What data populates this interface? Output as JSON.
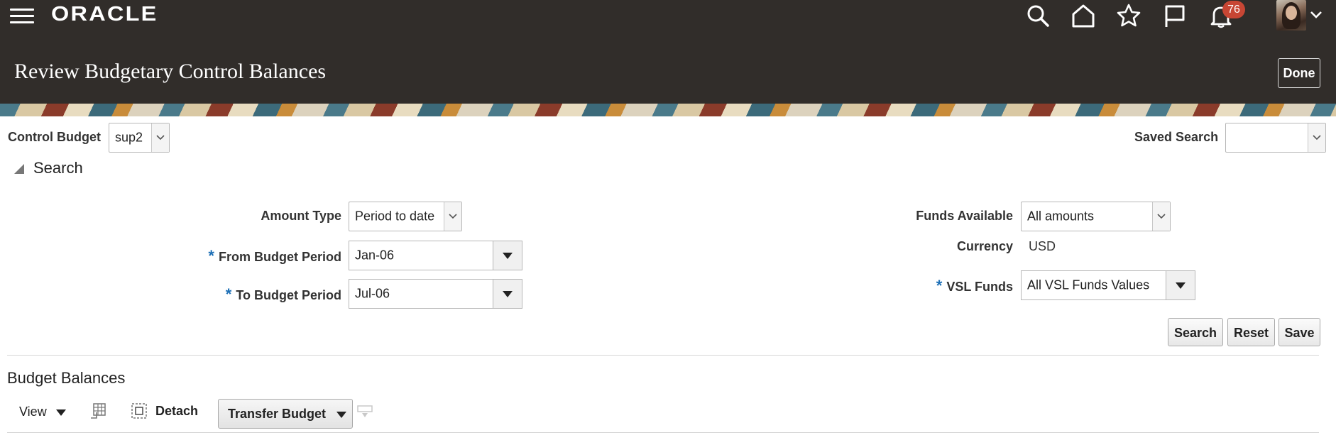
{
  "header": {
    "logo": "ORACLE",
    "notifications_count": "76",
    "page_title": "Review Budgetary Control Balances",
    "done_label": "Done"
  },
  "control_budget": {
    "label": "Control Budget",
    "value": "sup2"
  },
  "saved_search": {
    "label": "Saved Search",
    "value": ""
  },
  "search": {
    "title": "Search",
    "amount_type": {
      "label": "Amount Type",
      "value": "Period to date"
    },
    "from_period": {
      "required": "*",
      "label": "From Budget Period",
      "value": "Jan-06"
    },
    "to_period": {
      "required": "*",
      "label": "To Budget Period",
      "value": "Jul-06"
    },
    "funds_available": {
      "label": "Funds Available",
      "value": "All amounts"
    },
    "currency": {
      "label": "Currency",
      "value": "USD"
    },
    "vsl_funds": {
      "required": "*",
      "label": "VSL Funds",
      "value": "All VSL Funds Values"
    },
    "buttons": {
      "search": "Search",
      "reset": "Reset",
      "save": "Save"
    }
  },
  "budget_balances": {
    "title": "Budget Balances",
    "toolbar": {
      "view": "View",
      "detach": "Detach",
      "transfer_budget": "Transfer Budget"
    }
  },
  "colors": {
    "header_bg": "#312d2a",
    "badge": "#c74634",
    "required": "#1c6fb6"
  }
}
